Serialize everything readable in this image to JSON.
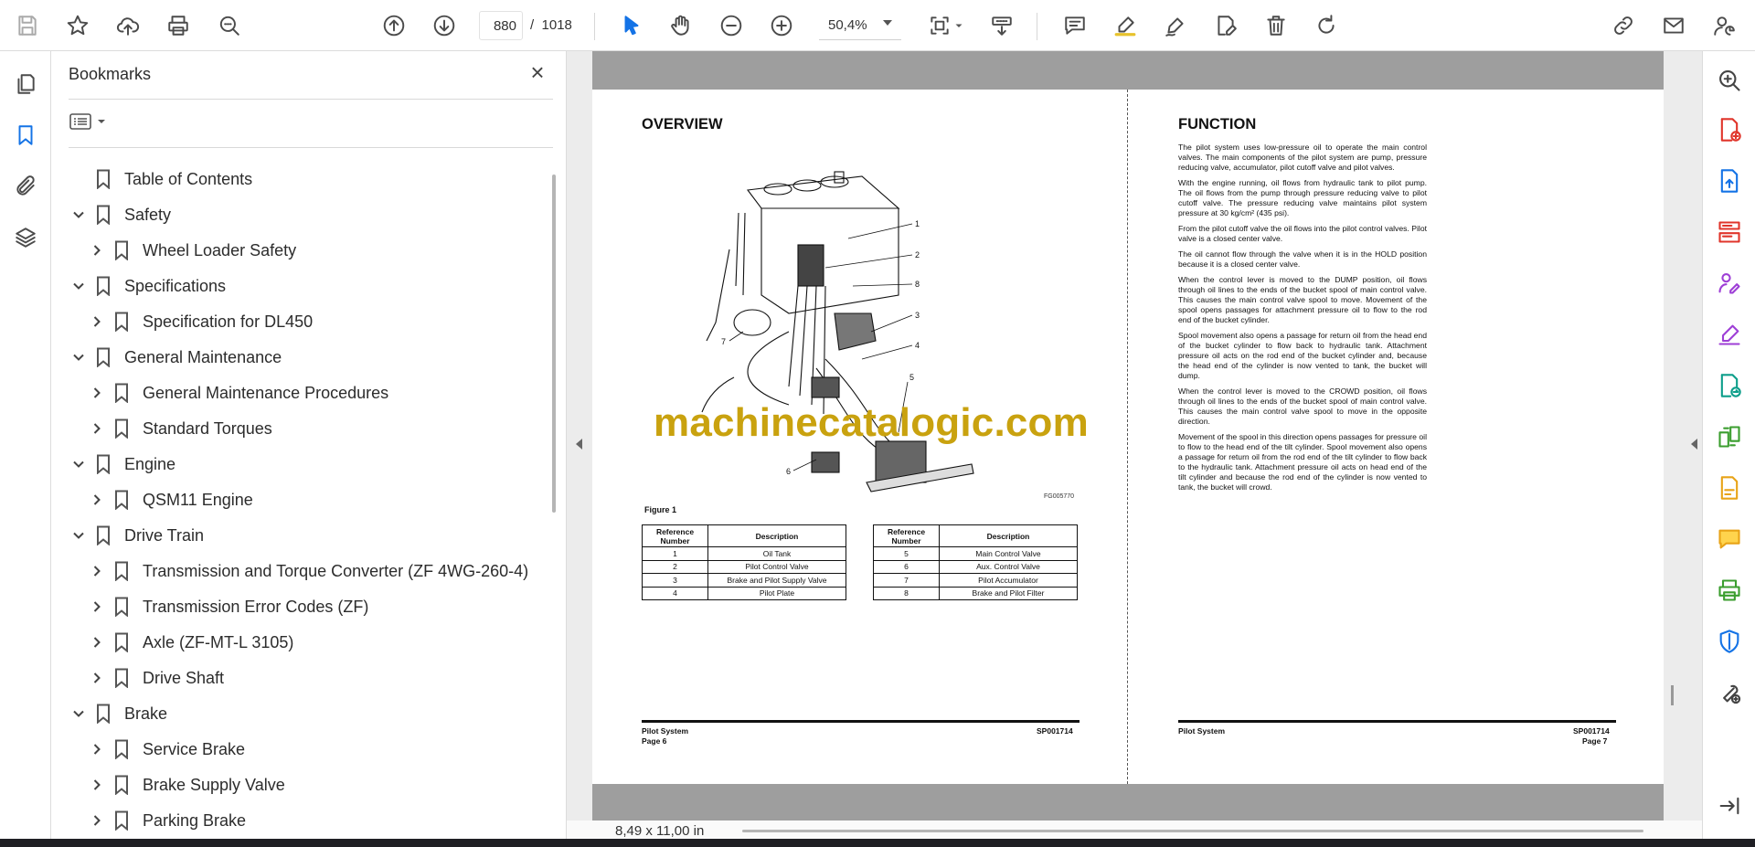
{
  "toolbar": {
    "current_page": "880",
    "page_separator": "/",
    "total_pages": "1018",
    "zoom": "50,4%"
  },
  "bookmarks": {
    "title": "Bookmarks",
    "items": [
      {
        "label": "Table of Contents",
        "level": 0,
        "state": "none"
      },
      {
        "label": "Safety",
        "level": 0,
        "state": "expanded"
      },
      {
        "label": "Wheel Loader Safety",
        "level": 1,
        "state": "collapsed"
      },
      {
        "label": "Specifications",
        "level": 0,
        "state": "expanded"
      },
      {
        "label": "Specification for DL450",
        "level": 1,
        "state": "collapsed"
      },
      {
        "label": "General Maintenance",
        "level": 0,
        "state": "expanded"
      },
      {
        "label": "General Maintenance Procedures",
        "level": 1,
        "state": "collapsed"
      },
      {
        "label": "Standard Torques",
        "level": 1,
        "state": "collapsed"
      },
      {
        "label": "Engine",
        "level": 0,
        "state": "expanded"
      },
      {
        "label": "QSM11 Engine",
        "level": 1,
        "state": "collapsed"
      },
      {
        "label": "Drive Train",
        "level": 0,
        "state": "expanded"
      },
      {
        "label": "Transmission and Torque Converter (ZF 4WG-260-4)",
        "level": 1,
        "state": "collapsed"
      },
      {
        "label": "Transmission Error Codes (ZF)",
        "level": 1,
        "state": "collapsed"
      },
      {
        "label": "Axle (ZF-MT-L 3105)",
        "level": 1,
        "state": "collapsed"
      },
      {
        "label": "Drive Shaft",
        "level": 1,
        "state": "collapsed"
      },
      {
        "label": "Brake",
        "level": 0,
        "state": "expanded"
      },
      {
        "label": "Service Brake",
        "level": 1,
        "state": "collapsed"
      },
      {
        "label": "Brake Supply Valve",
        "level": 1,
        "state": "collapsed"
      },
      {
        "label": "Parking Brake",
        "level": 1,
        "state": "collapsed"
      }
    ]
  },
  "document": {
    "left": {
      "heading": "OVERVIEW",
      "figure_caption": "Figure 1",
      "figure_id": "FG005770",
      "callouts": [
        "1",
        "2",
        "8",
        "3",
        "4",
        "5",
        "6",
        "7"
      ],
      "table_headers": {
        "ref": "Reference Number",
        "desc": "Description"
      },
      "table_left": [
        {
          "ref": "1",
          "desc": "Oil Tank"
        },
        {
          "ref": "2",
          "desc": "Pilot Control Valve"
        },
        {
          "ref": "3",
          "desc": "Brake and Pilot Supply Valve"
        },
        {
          "ref": "4",
          "desc": "Pilot Plate"
        }
      ],
      "table_right": [
        {
          "ref": "5",
          "desc": "Main Control Valve"
        },
        {
          "ref": "6",
          "desc": "Aux. Control Valve"
        },
        {
          "ref": "7",
          "desc": "Pilot Accumulator"
        },
        {
          "ref": "8",
          "desc": "Brake and Pilot Filter"
        }
      ],
      "footer_section": "Pilot System",
      "footer_code": "SP001714",
      "footer_page": "Page 6"
    },
    "right": {
      "heading": "FUNCTION",
      "paragraphs": [
        "The pilot system uses low-pressure oil to operate the main control valves. The main components of the pilot system are pump, pressure reducing valve, accumulator, pilot cutoff valve and pilot valves.",
        "With the engine running, oil flows from hydraulic tank to pilot pump. The oil flows from the pump through pressure reducing valve to pilot cutoff valve. The pressure reducing valve maintains pilot system pressure at 30 kg/cm² (435 psi).",
        "From the pilot cutoff valve the oil flows into the pilot control valves. Pilot valve is a closed center valve.",
        "The oil cannot flow through the valve when it is in the HOLD position because it is a closed center valve.",
        "When the control lever is moved to the DUMP position, oil flows through oil lines to the ends of the bucket spool of main control valve. This causes the main control valve spool to move. Movement of the spool opens passages for attachment pressure oil to flow to the rod end of the bucket cylinder.",
        "Spool movement also opens a passage for return oil from the head end of the bucket cylinder to flow back to hydraulic tank. Attachment pressure oil acts on the rod end of the bucket cylinder and, because the head end of the cylinder is now vented to tank, the bucket will dump.",
        "When the control lever is moved to the CROWD position, oil flows through oil lines to the ends of the bucket spool of main control valve. This causes the main control valve spool to move in the opposite direction.",
        "Movement of the spool in this direction opens passages for pressure oil to flow to the head end of the tilt cylinder. Spool movement also opens a passage for return oil from the rod end of the tilt cylinder to flow back to the hydraulic tank. Attachment pressure oil acts on head end of the tilt cylinder and because the rod end of the cylinder is now vented to tank, the bucket will crowd."
      ],
      "footer_section": "Pilot System",
      "footer_code": "SP001714",
      "footer_page": "Page 7"
    },
    "watermark": "machinecatalogic.com"
  },
  "status": {
    "page_size": "8,49 x 11,00 in"
  }
}
